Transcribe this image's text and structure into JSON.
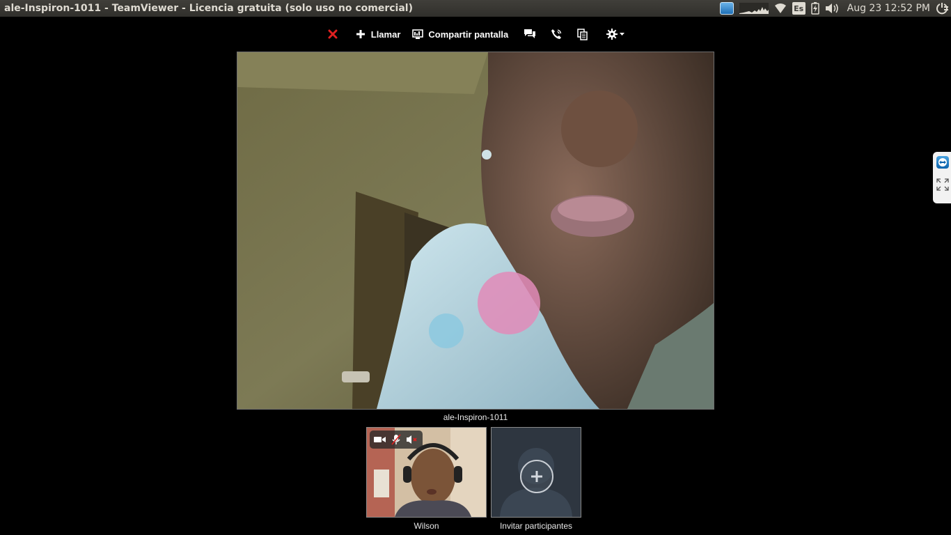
{
  "panel": {
    "window_title": "ale-Inspiron-1011 - TeamViewer - Licencia gratuita (solo uso no comercial)",
    "keyboard_layout": "Es",
    "clock": "Aug 23 12:52 PM",
    "tray_icons": [
      "teamviewer-icon",
      "system-monitor-graph",
      "wifi-icon",
      "keyboard-layout-badge",
      "battery-charging-icon",
      "volume-icon",
      "session-power-icon"
    ]
  },
  "toolbar": {
    "close_icon": "close-icon",
    "call_label": "Llamar",
    "share_label": "Compartir pantalla",
    "chat_icon": "chat-icon",
    "phone_icon": "phone-icon",
    "files_icon": "files-icon",
    "settings_icon": "gear-icon",
    "accent_close": "#e02020"
  },
  "main_video": {
    "caption": "ale-Inspiron-1011"
  },
  "participants": [
    {
      "name": "Wilson",
      "controls": [
        "camera-icon",
        "microphone-muted-icon",
        "speaker-muted-icon"
      ]
    },
    {
      "name": "Invitar participantes",
      "icon": "plus-icon"
    }
  ],
  "side_widget": {
    "icons": [
      "teamviewer-icon",
      "expand-icon"
    ]
  }
}
